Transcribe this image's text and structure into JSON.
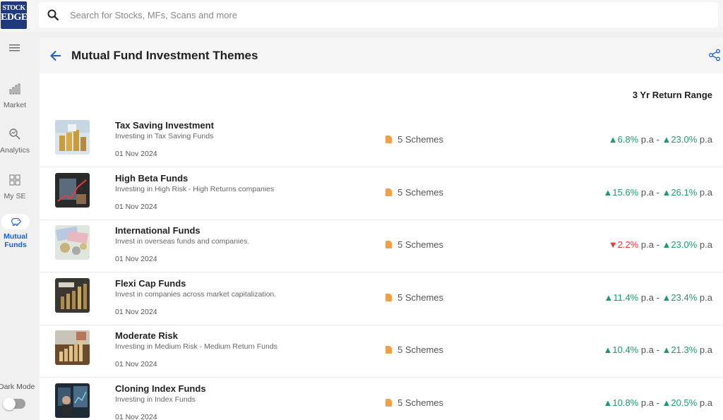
{
  "logo": {
    "line1": "STOCK",
    "line2": "EDGE"
  },
  "search": {
    "placeholder": "Search for Stocks, MFs, Scans and more"
  },
  "sidebar": {
    "items": [
      {
        "label": "Market",
        "icon": "bar-chart-icon"
      },
      {
        "label": "Analytics",
        "icon": "magnify-chart-icon"
      },
      {
        "label": "My SE",
        "icon": "grid-icon"
      },
      {
        "label": "Mutual Funds",
        "icon": "piggy-bank-icon",
        "active": true
      }
    ],
    "dark_mode_label": "Dark Mode",
    "dark_mode_on": false
  },
  "page": {
    "title": "Mutual Fund Investment Themes",
    "column_header": "3 Yr Return Range"
  },
  "colors": {
    "accent": "#1a62c9",
    "positive": "#1a9c6b",
    "negative": "#e53935",
    "scheme_icon": "#f0a04b"
  },
  "themes": [
    {
      "title": "Tax Saving Investment",
      "desc": "Investing in Tax Saving Funds",
      "date": "01 Nov 2024",
      "schemes": "5 Schemes",
      "low": {
        "arrow": "▲",
        "dir": "up",
        "value": "6.8%"
      },
      "high": {
        "arrow": "▲",
        "dir": "up",
        "value": "23.0%"
      },
      "unit": "p.a",
      "sep": "-"
    },
    {
      "title": "High Beta Funds",
      "desc": "Investing in High Risk - High Returns companies",
      "date": "01 Nov 2024",
      "schemes": "5 Schemes",
      "low": {
        "arrow": "▲",
        "dir": "up",
        "value": "15.6%"
      },
      "high": {
        "arrow": "▲",
        "dir": "up",
        "value": "26.1%"
      },
      "unit": "p.a",
      "sep": "-"
    },
    {
      "title": "International Funds",
      "desc": "Invest in overseas funds and companies.",
      "date": "01 Nov 2024",
      "schemes": "5 Schemes",
      "low": {
        "arrow": "▼",
        "dir": "down",
        "value": "2.2%"
      },
      "high": {
        "arrow": "▲",
        "dir": "up",
        "value": "23.0%"
      },
      "unit": "p.a",
      "sep": "-"
    },
    {
      "title": "Flexi Cap Funds",
      "desc": "Invest in companies across market capitalization.",
      "date": "01 Nov 2024",
      "schemes": "5 Schemes",
      "low": {
        "arrow": "▲",
        "dir": "up",
        "value": "11.4%"
      },
      "high": {
        "arrow": "▲",
        "dir": "up",
        "value": "23.4%"
      },
      "unit": "p.a",
      "sep": "-"
    },
    {
      "title": "Moderate Risk",
      "desc": "Investing in Medium Risk - Medium Return Funds",
      "date": "01 Nov 2024",
      "schemes": "5 Schemes",
      "low": {
        "arrow": "▲",
        "dir": "up",
        "value": "10.4%"
      },
      "high": {
        "arrow": "▲",
        "dir": "up",
        "value": "21.3%"
      },
      "unit": "p.a",
      "sep": "-"
    },
    {
      "title": "Cloning Index Funds",
      "desc": "Investing in Index Funds",
      "date": "01 Nov 2024",
      "schemes": "5 Schemes",
      "low": {
        "arrow": "▲",
        "dir": "up",
        "value": "10.8%"
      },
      "high": {
        "arrow": "▲",
        "dir": "up",
        "value": "20.5%"
      },
      "unit": "p.a",
      "sep": "-"
    }
  ]
}
